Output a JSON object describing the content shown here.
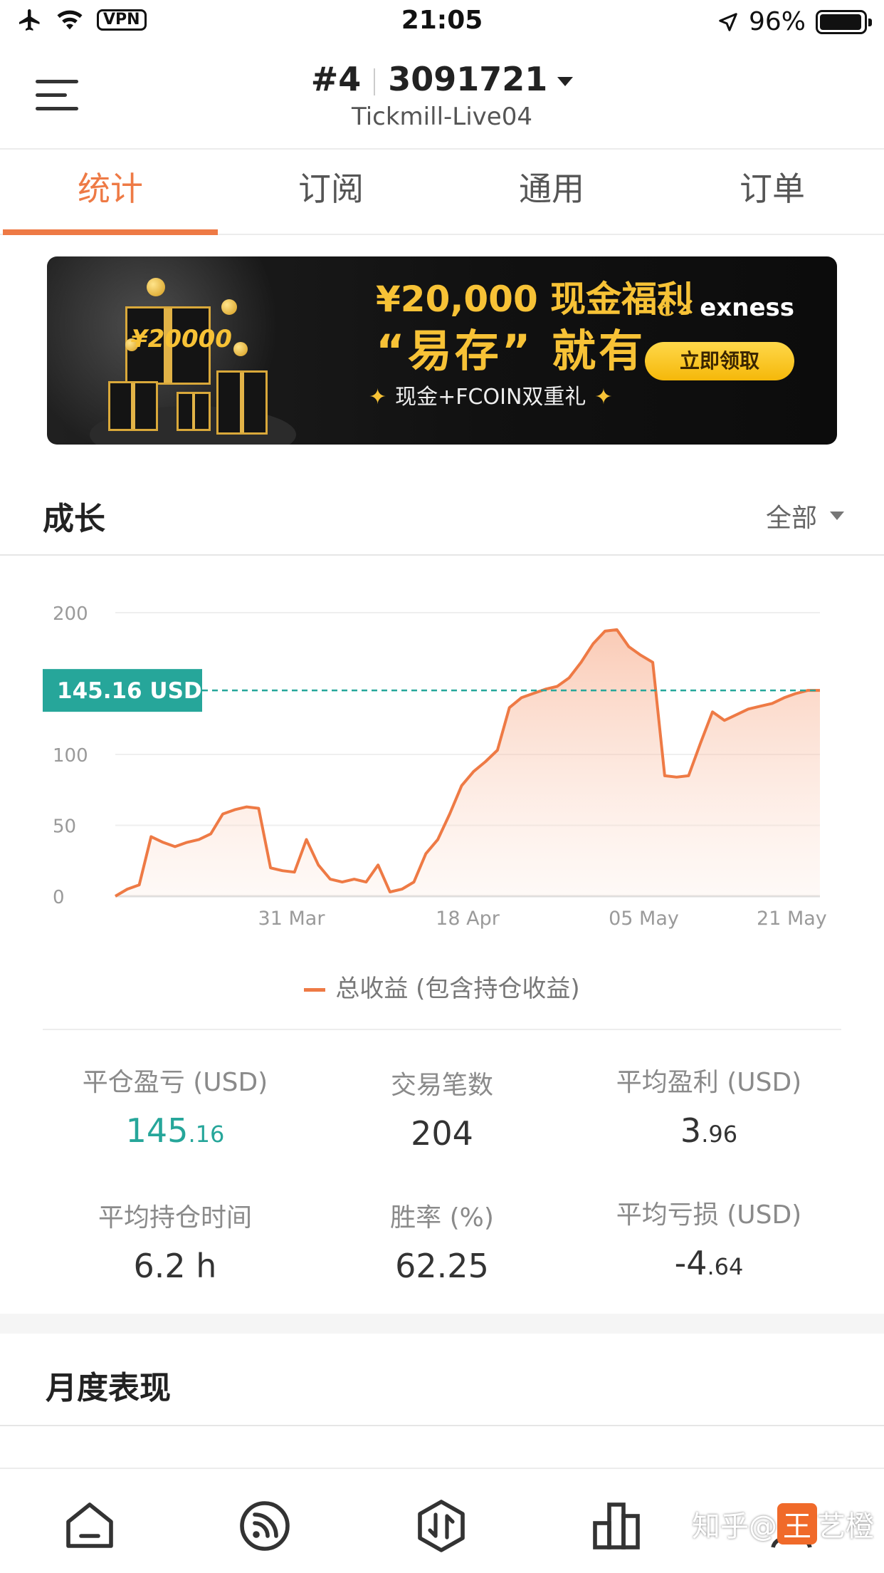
{
  "status_bar": {
    "time": "21:05",
    "vpn": "VPN",
    "battery": "96%",
    "battery_level": 0.96,
    "icons": [
      "airplane-icon",
      "wifi-icon",
      "location-arrow-icon",
      "battery-icon"
    ]
  },
  "header": {
    "account_index": "#4",
    "account_number": "3091721",
    "server": "Tickmill-Live04",
    "icons": [
      "menu-icon",
      "chevron-down-icon"
    ]
  },
  "tabs": [
    {
      "label": "统计",
      "active": true
    },
    {
      "label": "订阅",
      "active": false
    },
    {
      "label": "通用",
      "active": false
    },
    {
      "label": "订单",
      "active": false
    }
  ],
  "banner": {
    "headline": "¥20,000 现金福利",
    "slogan": "“易存” 就有",
    "sub": "现金+FCOIN双重礼",
    "star": "✦",
    "brand": "exness",
    "cta": "立即领取",
    "gift_amount": "¥20000"
  },
  "growth": {
    "title": "成长",
    "range": "全部",
    "legend": "总收益 (包含持仓收益)"
  },
  "chart_data": {
    "type": "area",
    "y_ticks": [
      "0",
      "50",
      "100",
      "200"
    ],
    "ylim": [
      0,
      200
    ],
    "x_ticks": [
      "31 Mar",
      "18 Apr",
      "05 May",
      "21 May"
    ],
    "current_label": "145.16 USD",
    "current_value": 145.16,
    "series": [
      {
        "values": [
          0,
          5,
          8,
          42,
          38,
          35,
          38,
          40,
          44,
          58,
          61,
          63,
          62,
          20,
          18,
          17,
          40,
          22,
          12,
          10,
          12,
          10,
          22,
          3,
          5,
          10,
          30,
          40,
          58,
          78,
          88,
          95,
          103,
          133,
          140,
          143,
          146,
          148,
          154,
          165,
          178,
          187,
          188,
          176,
          170,
          165,
          85,
          84,
          85,
          108,
          130,
          124,
          128,
          132,
          134,
          136,
          140,
          143,
          145.16,
          145.16
        ]
      }
    ],
    "colors": {
      "line": "#ee7a45",
      "area": "#fbd9c8",
      "ref_line": "#26a69a",
      "label_bg": "#26a69a"
    }
  },
  "stats": [
    {
      "label": "平仓盈亏 (USD)",
      "int": "145",
      "dec": ".16",
      "green": true
    },
    {
      "label": "交易笔数",
      "int": "204",
      "dec": "",
      "green": false
    },
    {
      "label": "平均盈利 (USD)",
      "int": "3",
      "dec": ".96",
      "green": false
    },
    {
      "label": "平均持仓时间",
      "int": "6.2 h",
      "dec": "",
      "green": false
    },
    {
      "label": "胜率 (%)",
      "int": "62.25",
      "dec": "",
      "green": false
    },
    {
      "label": "平均亏损 (USD)",
      "int": "-4",
      "dec": ".64",
      "green": false
    }
  ],
  "monthly": {
    "title": "月度表现"
  },
  "bottom_nav": {
    "items": [
      "home-icon",
      "feed-icon",
      "trade-icon",
      "chart-bar-icon",
      "profile-icon"
    ]
  },
  "watermark": {
    "prefix": "知乎",
    "at": "@",
    "badge": "王",
    "name": "艺橙"
  },
  "accent": "#ee7a45",
  "positive_color": "#26a69a"
}
